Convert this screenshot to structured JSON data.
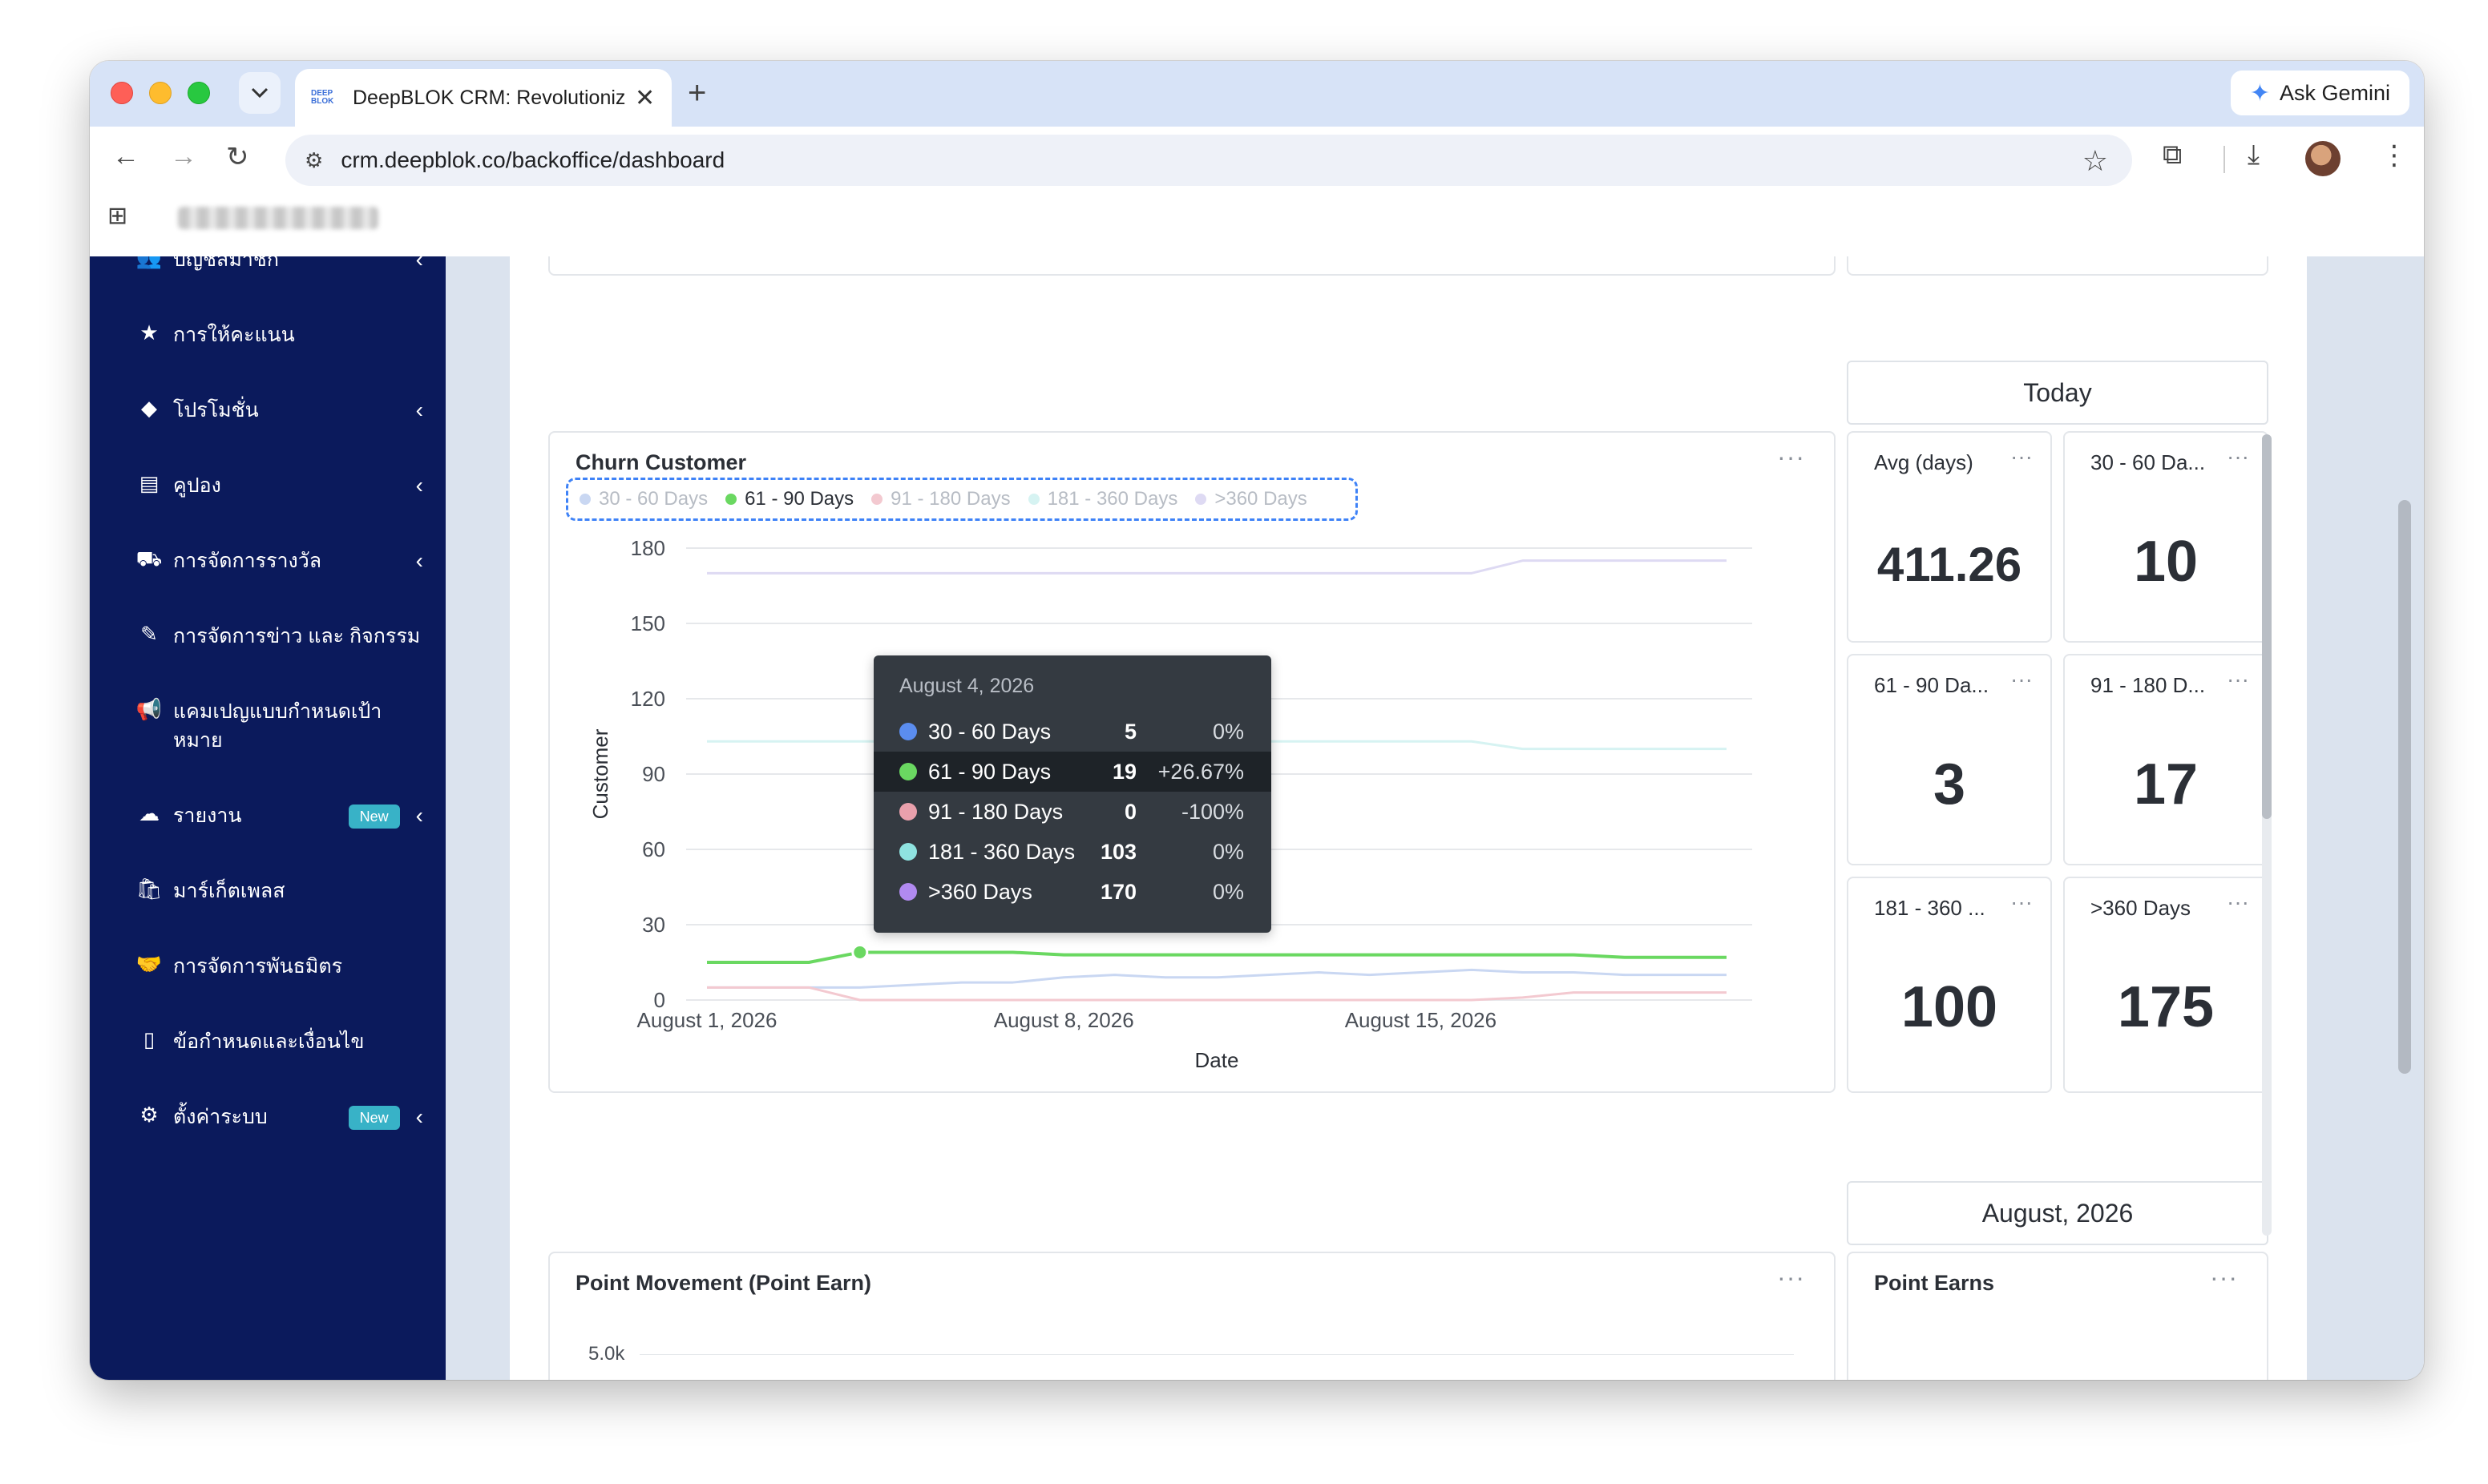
{
  "browser": {
    "tab_title": "DeepBLOK CRM: Revolutioniz",
    "favicon_text_top": "DEEP",
    "favicon_text_bottom": "BLOK",
    "new_tab": "+",
    "tab_close": "✕",
    "ask_gemini": "Ask Gemini",
    "url": "crm.deepblok.co/backoffice/dashboard"
  },
  "sidebar": {
    "items": [
      {
        "label": "บัญชีสมาชิก",
        "icon": "users-icon",
        "chevron": true
      },
      {
        "label": "การให้คะแนน",
        "icon": "star-icon",
        "chevron": false
      },
      {
        "label": "โปรโมชั่น",
        "icon": "tag-icon",
        "chevron": true
      },
      {
        "label": "คูปอง",
        "icon": "ticket-icon",
        "chevron": true
      },
      {
        "label": "การจัดการรางวัล",
        "icon": "cart-icon",
        "chevron": true
      },
      {
        "label": "การจัดการข่าว และ กิจกรรม",
        "icon": "edit-icon",
        "chevron": false
      },
      {
        "label": "แคมเปญแบบกำหนดเป้าหมาย",
        "icon": "megaphone-icon",
        "chevron": false
      },
      {
        "label": "รายงาน",
        "icon": "cloud-icon",
        "chevron": true,
        "badge": "New"
      },
      {
        "label": "มาร์เก็ตเพลส",
        "icon": "bag-icon",
        "chevron": false
      },
      {
        "label": "การจัดการพันธมิตร",
        "icon": "handshake-icon",
        "chevron": false
      },
      {
        "label": "ข้อกำหนดและเงื่อนไข",
        "icon": "document-icon",
        "chevron": false
      },
      {
        "label": "ตั้งค่าระบบ",
        "icon": "gear-icon",
        "chevron": true,
        "badge": "New"
      }
    ]
  },
  "dashboard": {
    "today_header": "Today",
    "month_header": "August, 2026",
    "churn_card": {
      "title": "Churn Customer",
      "menu": "···"
    },
    "kpis": [
      {
        "title": "Avg (days)",
        "value": "411.26"
      },
      {
        "title": "30 - 60 Da...",
        "value": "10"
      },
      {
        "title": "61 - 90 Da...",
        "value": "3"
      },
      {
        "title": "91 - 180 D...",
        "value": "17"
      },
      {
        "title": "181 - 360 ...",
        "value": "100"
      },
      {
        "title": ">360 Days",
        "value": "175"
      }
    ],
    "point_movement": {
      "title": "Point Movement (Point Earn)",
      "ytick": "5.0k"
    },
    "point_earns": {
      "title": "Point Earns"
    },
    "tooltip": {
      "date": "August 4, 2026",
      "rows": [
        {
          "name": "30 - 60 Days",
          "value": "5",
          "pct": "0%",
          "color": "#5b8def"
        },
        {
          "name": "61 - 90 Days",
          "value": "19",
          "pct": "+26.67%",
          "color": "#6ad861"
        },
        {
          "name": "91 - 180 Days",
          "value": "0",
          "pct": "-100%",
          "color": "#e9a0ac"
        },
        {
          "name": "181 - 360 Days",
          "value": "103",
          "pct": "0%",
          "color": "#8fe3e0"
        },
        {
          "name": ">360 Days",
          "value": "170",
          "pct": "0%",
          "color": "#b18af0"
        }
      ]
    }
  },
  "chart_data": {
    "type": "line",
    "title": "Churn Customer",
    "xlabel": "Date",
    "ylabel": "Customer",
    "ylim": [
      0,
      180
    ],
    "yticks": [
      0,
      30,
      60,
      90,
      120,
      150,
      180
    ],
    "xtick_labels": [
      "August 1, 2026",
      "August 8, 2026",
      "August 15, 2026"
    ],
    "x": [
      "2026-08-01",
      "2026-08-02",
      "2026-08-03",
      "2026-08-04",
      "2026-08-05",
      "2026-08-06",
      "2026-08-07",
      "2026-08-08",
      "2026-08-09",
      "2026-08-10",
      "2026-08-11",
      "2026-08-12",
      "2026-08-13",
      "2026-08-14",
      "2026-08-15",
      "2026-08-16",
      "2026-08-17",
      "2026-08-18",
      "2026-08-19",
      "2026-08-20",
      "2026-08-21"
    ],
    "legend_position": "top-left",
    "active_series": "61 - 90 Days",
    "series": [
      {
        "name": "30 - 60 Days",
        "color": "#c9d7f2",
        "values": [
          5,
          5,
          5,
          5,
          6,
          7,
          7,
          9,
          10,
          9,
          9,
          10,
          11,
          10,
          11,
          12,
          11,
          11,
          10,
          10,
          10
        ]
      },
      {
        "name": "61 - 90 Days",
        "color": "#6ad861",
        "values": [
          15,
          15,
          15,
          19,
          19,
          19,
          19,
          18,
          18,
          18,
          18,
          18,
          18,
          18,
          18,
          18,
          18,
          18,
          17,
          17,
          17
        ]
      },
      {
        "name": "91 - 180 Days",
        "color": "#f3c9d0",
        "values": [
          5,
          5,
          5,
          0,
          0,
          0,
          0,
          0,
          0,
          0,
          0,
          0,
          0,
          0,
          0,
          0,
          1,
          3,
          3,
          3,
          3
        ]
      },
      {
        "name": "181 - 360 Days",
        "color": "#d6f3f2",
        "values": [
          103,
          103,
          103,
          103,
          103,
          103,
          103,
          103,
          103,
          103,
          103,
          103,
          103,
          103,
          103,
          103,
          100,
          100,
          100,
          100,
          100
        ]
      },
      {
        "name": ">360 Days",
        "color": "#dedaf3",
        "values": [
          170,
          170,
          170,
          170,
          170,
          170,
          170,
          170,
          170,
          170,
          170,
          170,
          170,
          170,
          170,
          170,
          175,
          175,
          175,
          175,
          175
        ]
      }
    ]
  }
}
